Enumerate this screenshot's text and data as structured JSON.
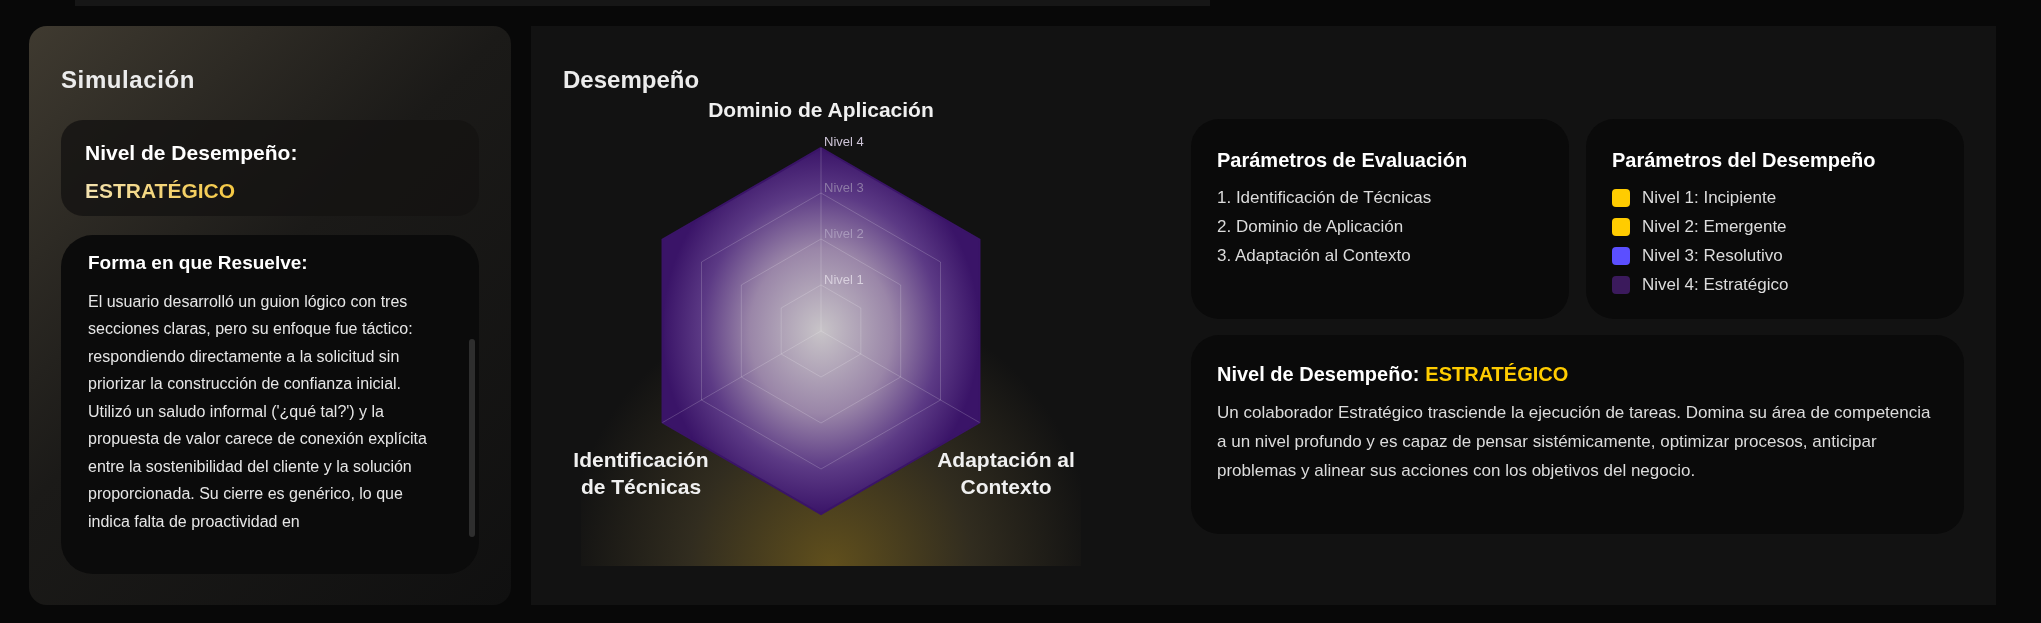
{
  "simulation": {
    "title": "Simulación",
    "level_card": {
      "label": "Nivel de Desempeño:",
      "value": "ESTRATÉGICO"
    },
    "resolution": {
      "title": "Forma en que Resuelve:",
      "text": "El usuario desarrolló un guion lógico con tres secciones claras, pero su enfoque fue táctico: respondiendo directamente a la solicitud sin priorizar la construcción de confianza inicial. Utilizó un saludo informal ('¿qué tal?') y la propuesta de valor carece de conexión explícita entre la sostenibilidad del cliente y la solución proporcionada. Su cierre es genérico, lo que indica falta de proactividad en"
    }
  },
  "performance": {
    "title": "Desempeño",
    "radar": {
      "axes": [
        "Dominio de Aplicación",
        "Identificación de Técnicas",
        "Adaptación al Contexto"
      ],
      "levels": [
        "Nivel 4",
        "Nivel 3",
        "Nivel 2",
        "Nivel 1"
      ]
    },
    "evaluation": {
      "title": "Parámetros de Evaluación",
      "items": [
        "1. Identificación de Técnicas",
        "2. Dominio de Aplicación",
        "3. Adaptación al Contexto"
      ]
    },
    "legend": {
      "title": "Parámetros del Desempeño",
      "items": [
        {
          "label": "Nivel 1: Incipiente",
          "color": "#ffcc00"
        },
        {
          "label": "Nivel 2: Emergente",
          "color": "#ffcc00"
        },
        {
          "label": "Nivel 3: Resolutivo",
          "color": "#5b4fff"
        },
        {
          "label": "Nivel 4: Estratégico",
          "color": "#3b1a5c"
        }
      ]
    },
    "level_summary": {
      "label": "Nivel de Desempeño:",
      "value": "ESTRATÉGICO",
      "description": "Un colaborador Estratégico trasciende la ejecución de tareas. Domina su área de competencia a un nivel profundo y es capaz de pensar sistémicamente, optimizar procesos, anticipar problemas y alinear sus acciones con los objetivos del negocio."
    }
  }
}
